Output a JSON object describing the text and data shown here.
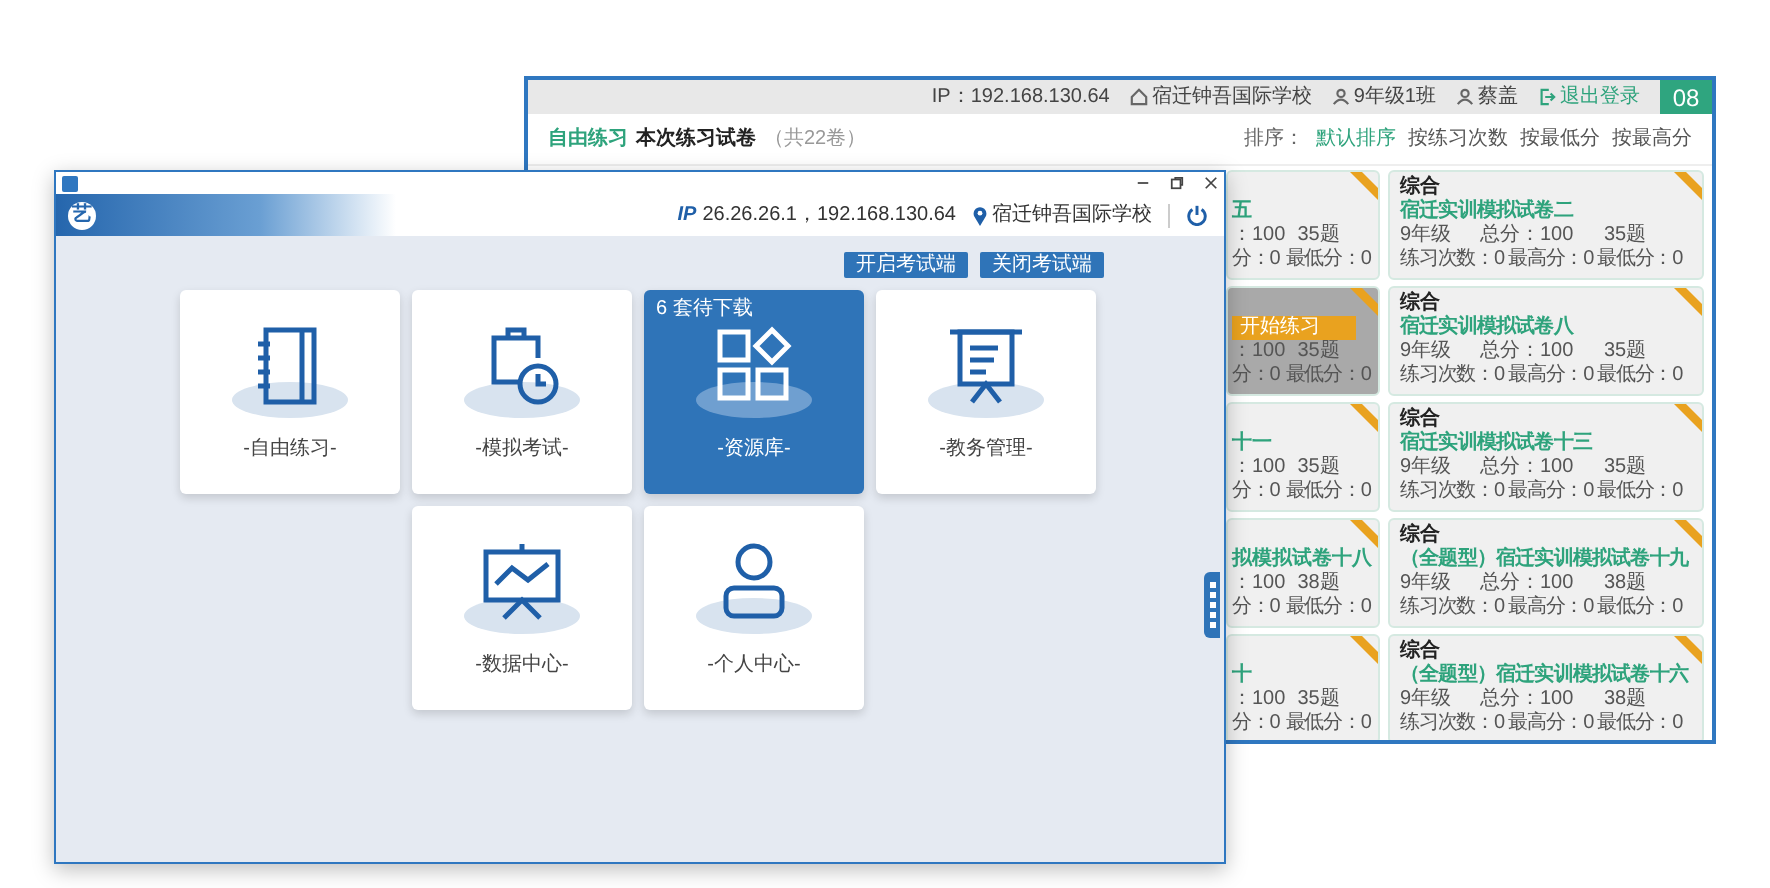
{
  "back_window": {
    "ip": "IP：192.168.130.64",
    "school": "宿迁钟吾国际学校",
    "class_name": "9年级1班",
    "user": "蔡盖",
    "logout": "退出登录",
    "number": "08",
    "section": "自由练习",
    "heading": "本次练习试卷",
    "count": "（共22卷）",
    "sort_label": "排序：",
    "sort_options": [
      {
        "label": "默认排序",
        "selected": true
      },
      {
        "label": "按练习次数",
        "selected": false
      },
      {
        "label": "按最低分",
        "selected": false
      },
      {
        "label": "按最高分",
        "selected": false
      }
    ],
    "partial_cards": [
      {
        "title": "五",
        "hover": false,
        "total": "：100",
        "questions": "35题",
        "high": "分：0",
        "low": "最低分：0"
      },
      {
        "hover": true,
        "action": "开始练习",
        "total": "：100",
        "questions": "35题",
        "high": "分：0",
        "low": "最低分：0"
      },
      {
        "title": "十一",
        "hover": false,
        "total": "：100",
        "questions": "35题",
        "high": "分：0",
        "low": "最低分：0"
      },
      {
        "title": "拟模拟试卷十八",
        "hover": false,
        "total": "：100",
        "questions": "38题",
        "high": "分：0",
        "low": "最低分：0"
      },
      {
        "title": "十",
        "hover": false,
        "total": "：100",
        "questions": "35题",
        "high": "分：0",
        "low": "最低分：0"
      }
    ],
    "cards": [
      {
        "subject": "综合",
        "title": "宿迁实训模拟试卷二",
        "grade": "9年级",
        "total": "总分：100",
        "questions": "35题",
        "practice": "练习次数：0",
        "high": "最高分：0",
        "low": "最低分：0"
      },
      {
        "subject": "综合",
        "title": "宿迁实训模拟试卷八",
        "grade": "9年级",
        "total": "总分：100",
        "questions": "35题",
        "practice": "练习次数：0",
        "high": "最高分：0",
        "low": "最低分：0"
      },
      {
        "subject": "综合",
        "title": "宿迁实训模拟试卷十三",
        "grade": "9年级",
        "total": "总分：100",
        "questions": "35题",
        "practice": "练习次数：0",
        "high": "最高分：0",
        "low": "最低分：0"
      },
      {
        "subject": "综合",
        "title": "（全题型）宿迁实训模拟试卷十九",
        "grade": "9年级",
        "total": "总分：100",
        "questions": "38题",
        "practice": "练习次数：0",
        "high": "最高分：0",
        "low": "最低分：0"
      },
      {
        "subject": "综合",
        "title": "（全题型）宿迁实训模拟试卷十六",
        "grade": "9年级",
        "total": "总分：100",
        "questions": "38题",
        "practice": "练习次数：0",
        "high": "最高分：0",
        "low": "最低分：0"
      }
    ]
  },
  "front_window": {
    "logo_char": "艺",
    "ip_label": "IP",
    "ip_value": "26.26.26.1，192.168.130.64",
    "school": "宿迁钟吾国际学校",
    "buttons": [
      "开启考试端",
      "关闭考试端"
    ],
    "tiles": [
      {
        "kind": "notebook",
        "label": "-自由练习-",
        "selected": false
      },
      {
        "kind": "clipboard",
        "label": "-模拟考试-",
        "selected": false
      },
      {
        "kind": "blocks",
        "label": "-资源库-",
        "selected": true,
        "badge": "6 套待下载"
      },
      {
        "kind": "board",
        "label": "-教务管理-",
        "selected": false
      },
      {
        "kind": "chart",
        "label": "-数据中心-",
        "selected": false
      },
      {
        "kind": "person",
        "label": "-个人中心-",
        "selected": false
      }
    ]
  }
}
